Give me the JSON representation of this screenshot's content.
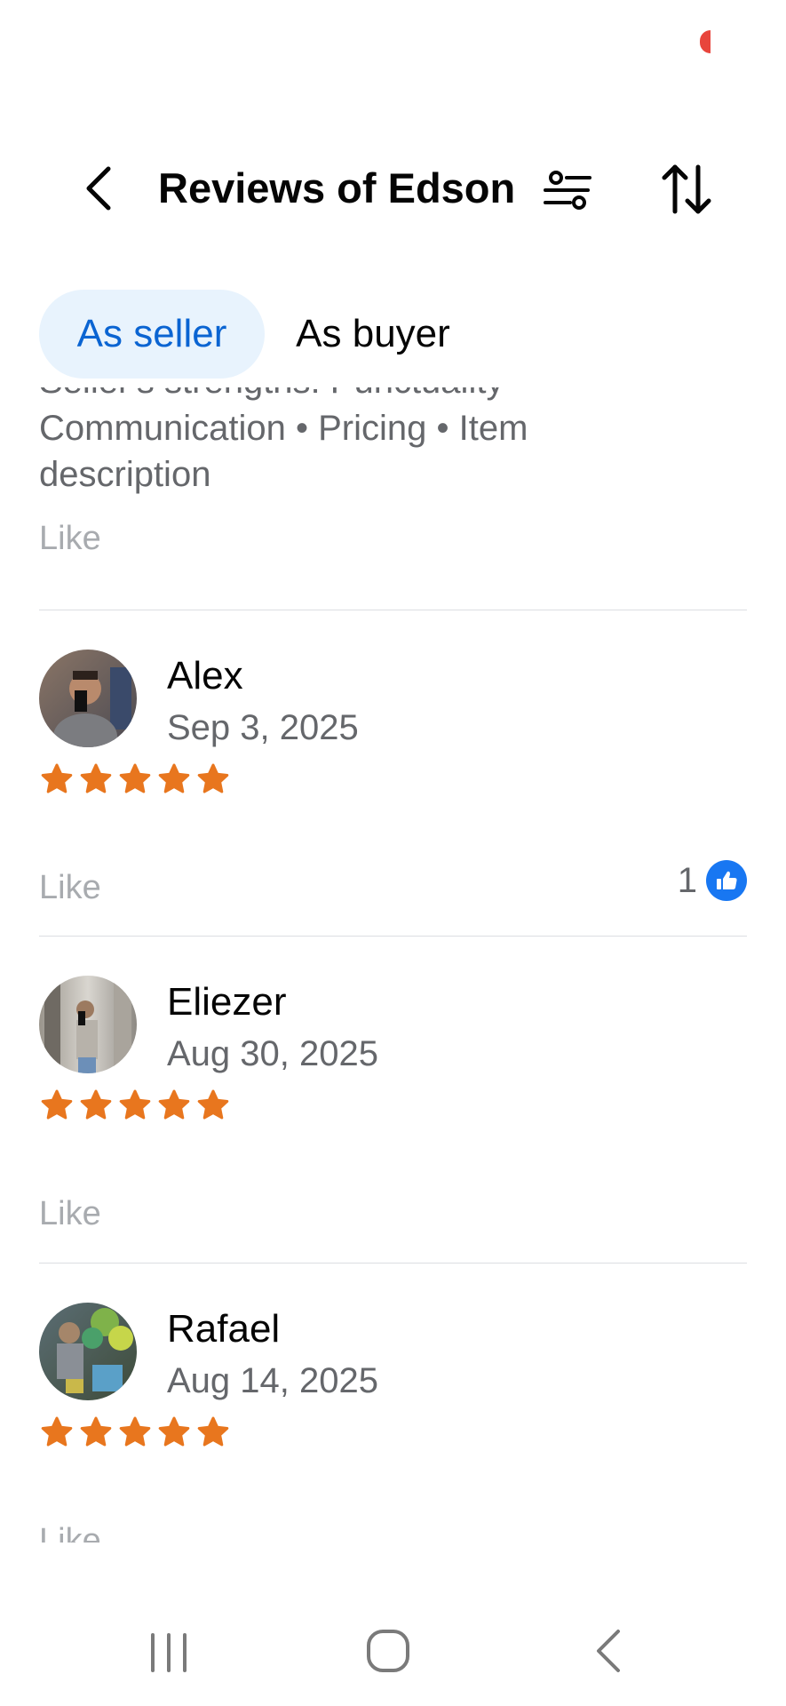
{
  "header": {
    "title": "Reviews of Edson",
    "back_icon": "chevron-left-icon",
    "filter_icon": "sliders-icon",
    "sort_icon": "sort-arrows-icon"
  },
  "tabs": [
    {
      "label": "As seller",
      "selected": true
    },
    {
      "label": "As buyer",
      "selected": false
    }
  ],
  "partial_review": {
    "strengths_partial": "Seller's strengths: Punctuality",
    "strengths_rest": "Communication • Pricing • Item description",
    "like_label": "Like"
  },
  "reviews": [
    {
      "name": "Alex",
      "date": "Sep 3, 2025",
      "rating": 5,
      "like_label": "Like",
      "like_count": "1"
    },
    {
      "name": "Eliezer",
      "date": "Aug 30, 2025",
      "rating": 5,
      "like_label": "Like"
    },
    {
      "name": "Rafael",
      "date": "Aug 14, 2025",
      "rating": 5,
      "like_label": "Like"
    }
  ],
  "colors": {
    "accent": "#0a64d2",
    "tab_bg": "#e8f3fd",
    "star": "#e8761e",
    "like_badge": "#1877f2",
    "muted_text": "#65676b",
    "like_text": "#a8abaf"
  },
  "navbar": {
    "icons": [
      "recent-apps-icon",
      "home-icon",
      "back-icon"
    ]
  }
}
